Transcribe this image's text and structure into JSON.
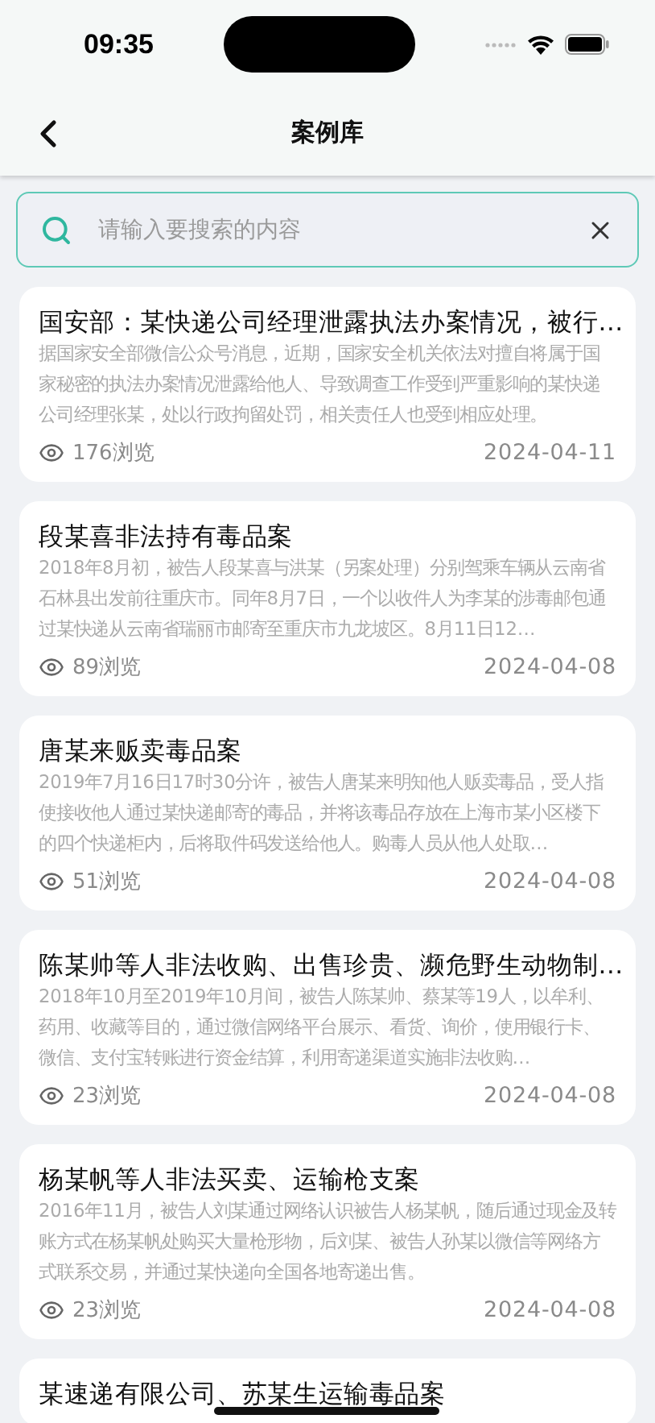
{
  "status_bar": {
    "time": "09:35"
  },
  "nav": {
    "title": "案例库"
  },
  "search": {
    "placeholder": "请输入要搜索的内容"
  },
  "cases": [
    {
      "title": "国安部：某快递公司经理泄露执法办案情况，被行…",
      "summary": "据国家安全部微信公众号消息，近期，国家安全机关依法对擅自将属于国家秘密的执法办案情况泄露给他人、导致调查工作受到严重影响的某快递公司经理张某，处以行政拘留处罚，相关责任人也受到相应处理。",
      "views": "176浏览",
      "date": "2024-04-11"
    },
    {
      "title": "段某喜非法持有毒品案",
      "summary": "2018年8月初，被告人段某喜与洪某（另案处理）分别驾乘车辆从云南省石林县出发前往重庆市。同年8月7日，一个以收件人为李某的涉毒邮包通过某快递从云南省瑞丽市邮寄至重庆市九龙坡区。8月11日12…",
      "views": "89浏览",
      "date": "2024-04-08"
    },
    {
      "title": "唐某来贩卖毒品案",
      "summary": "2019年7月16日17时30分许，被告人唐某来明知他人贩卖毒品，受人指使接收他人通过某快递邮寄的毒品，并将该毒品存放在上海市某小区楼下的四个快递柜内，后将取件码发送给他人。购毒人员从他人处取…",
      "views": "51浏览",
      "date": "2024-04-08"
    },
    {
      "title": "陈某帅等人非法收购、出售珍贵、濒危野生动物制…",
      "summary": "2018年10月至2019年10月间，被告人陈某帅、蔡某等19人，以牟利、药用、收藏等目的，通过微信网络平台展示、看货、询价，使用银行卡、微信、支付宝转账进行资金结算，利用寄递渠道实施非法收购…",
      "views": "23浏览",
      "date": "2024-04-08"
    },
    {
      "title": "杨某帆等人非法买卖、运输枪支案",
      "summary": "2016年11月，被告人刘某通过网络认识被告人杨某帆，随后通过现金及转账方式在杨某帆处购买大量枪形物，后刘某、被告人孙某以微信等网络方式联系交易，并通过某快递向全国各地寄递出售。",
      "views": "23浏览",
      "date": "2024-04-08"
    },
    {
      "title": "某速递有限公司、苏某生运输毒品案"
    }
  ]
}
